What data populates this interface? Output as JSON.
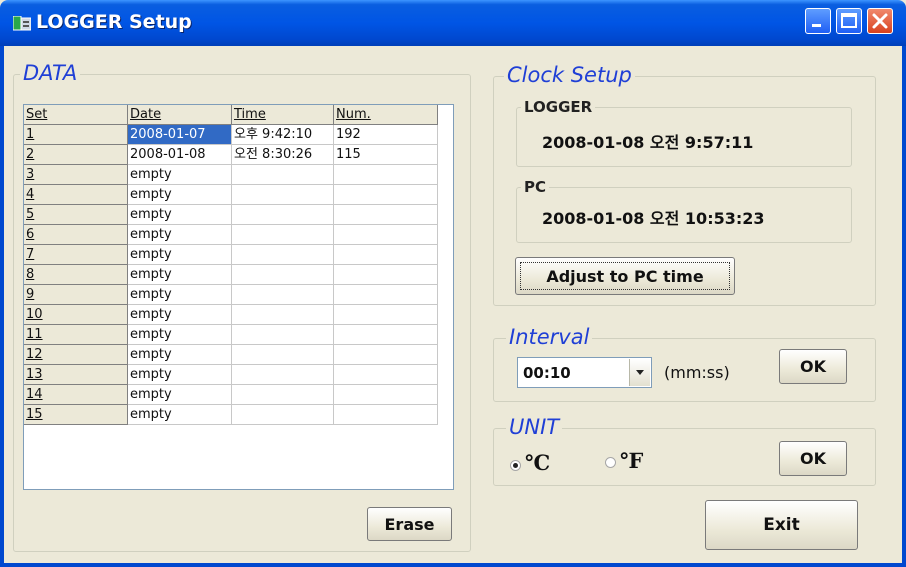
{
  "window": {
    "title": "LOGGER Setup"
  },
  "data_group": {
    "legend": "DATA",
    "columns": [
      "Set",
      "Date",
      "Time",
      "Num."
    ],
    "rows": [
      [
        "1",
        "2008-01-07",
        "오후 9:42:10",
        "192"
      ],
      [
        "2",
        "2008-01-08",
        "오전 8:30:26",
        "115"
      ],
      [
        "3",
        "empty",
        "",
        ""
      ],
      [
        "4",
        "empty",
        "",
        ""
      ],
      [
        "5",
        "empty",
        "",
        ""
      ],
      [
        "6",
        "empty",
        "",
        ""
      ],
      [
        "7",
        "empty",
        "",
        ""
      ],
      [
        "8",
        "empty",
        "",
        ""
      ],
      [
        "9",
        "empty",
        "",
        ""
      ],
      [
        "10",
        "empty",
        "",
        ""
      ],
      [
        "11",
        "empty",
        "",
        ""
      ],
      [
        "12",
        "empty",
        "",
        ""
      ],
      [
        "13",
        "empty",
        "",
        ""
      ],
      [
        "14",
        "empty",
        "",
        ""
      ],
      [
        "15",
        "empty",
        "",
        ""
      ]
    ],
    "erase_label": "Erase"
  },
  "clock": {
    "legend": "Clock Setup",
    "logger_legend": "LOGGER",
    "logger_time": "2008-01-08 오전 9:57:11",
    "pc_legend": "PC",
    "pc_time": "2008-01-08 오전 10:53:23",
    "adjust_label": "Adjust to PC time"
  },
  "interval": {
    "legend": "Interval",
    "value": "00:10",
    "unit_text": "(mm:ss)",
    "ok_label": "OK"
  },
  "unit": {
    "legend": "UNIT",
    "celsius_label": "℃",
    "fahrenheit_label": "℉",
    "selected": "celsius",
    "ok_label": "OK"
  },
  "exit_label": "Exit",
  "colors": {
    "titlebar": "#0055e5",
    "legend_blue": "#1f3fd6",
    "selection": "#316ac5",
    "face": "#ece9d8"
  }
}
